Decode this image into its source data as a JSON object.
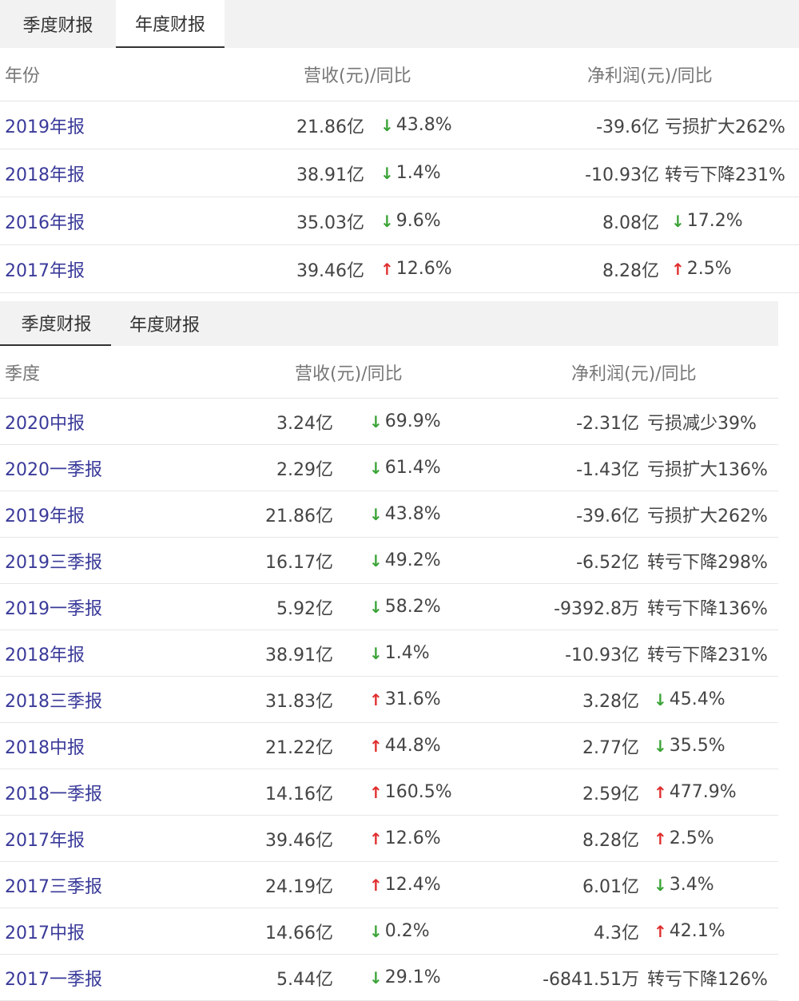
{
  "annual_panel": {
    "tabs": [
      {
        "label": "季度财报",
        "active": false
      },
      {
        "label": "年度财报",
        "active": true
      }
    ],
    "headers": {
      "period": "年份",
      "revenue": "营收(元)/同比",
      "net_profit": "净利润(元)/同比"
    },
    "rows": [
      {
        "period": "2019年报",
        "revenue": "21.86亿",
        "revenue_dir": "down",
        "revenue_yoy": "43.8%",
        "net_profit": "-39.6亿",
        "np_dir": "none",
        "np_change": "亏损扩大262%"
      },
      {
        "period": "2018年报",
        "revenue": "38.91亿",
        "revenue_dir": "down",
        "revenue_yoy": "1.4%",
        "net_profit": "-10.93亿",
        "np_dir": "none",
        "np_change": "转亏下降231%"
      },
      {
        "period": "2016年报",
        "revenue": "35.03亿",
        "revenue_dir": "down",
        "revenue_yoy": "9.6%",
        "net_profit": "8.08亿",
        "np_dir": "down",
        "np_change": "17.2%"
      },
      {
        "period": "2017年报",
        "revenue": "39.46亿",
        "revenue_dir": "up",
        "revenue_yoy": "12.6%",
        "net_profit": "8.28亿",
        "np_dir": "up",
        "np_change": "2.5%"
      }
    ]
  },
  "quarterly_panel": {
    "tabs": [
      {
        "label": "季度财报",
        "active": true
      },
      {
        "label": "年度财报",
        "active": false
      }
    ],
    "headers": {
      "period": "季度",
      "revenue": "营收(元)/同比",
      "net_profit": "净利润(元)/同比"
    },
    "rows": [
      {
        "period": "2020中报",
        "revenue": "3.24亿",
        "revenue_dir": "down",
        "revenue_yoy": "69.9%",
        "net_profit": "-2.31亿",
        "np_dir": "none",
        "np_change": "亏损减少39%"
      },
      {
        "period": "2020一季报",
        "revenue": "2.29亿",
        "revenue_dir": "down",
        "revenue_yoy": "61.4%",
        "net_profit": "-1.43亿",
        "np_dir": "none",
        "np_change": "亏损扩大136%"
      },
      {
        "period": "2019年报",
        "revenue": "21.86亿",
        "revenue_dir": "down",
        "revenue_yoy": "43.8%",
        "net_profit": "-39.6亿",
        "np_dir": "none",
        "np_change": "亏损扩大262%"
      },
      {
        "period": "2019三季报",
        "revenue": "16.17亿",
        "revenue_dir": "down",
        "revenue_yoy": "49.2%",
        "net_profit": "-6.52亿",
        "np_dir": "none",
        "np_change": "转亏下降298%"
      },
      {
        "period": "2019一季报",
        "revenue": "5.92亿",
        "revenue_dir": "down",
        "revenue_yoy": "58.2%",
        "net_profit": "-9392.8万",
        "np_dir": "none",
        "np_change": "转亏下降136%"
      },
      {
        "period": "2018年报",
        "revenue": "38.91亿",
        "revenue_dir": "down",
        "revenue_yoy": "1.4%",
        "net_profit": "-10.93亿",
        "np_dir": "none",
        "np_change": "转亏下降231%"
      },
      {
        "period": "2018三季报",
        "revenue": "31.83亿",
        "revenue_dir": "up",
        "revenue_yoy": "31.6%",
        "net_profit": "3.28亿",
        "np_dir": "down",
        "np_change": "45.4%"
      },
      {
        "period": "2018中报",
        "revenue": "21.22亿",
        "revenue_dir": "up",
        "revenue_yoy": "44.8%",
        "net_profit": "2.77亿",
        "np_dir": "down",
        "np_change": "35.5%"
      },
      {
        "period": "2018一季报",
        "revenue": "14.16亿",
        "revenue_dir": "up",
        "revenue_yoy": "160.5%",
        "net_profit": "2.59亿",
        "np_dir": "up",
        "np_change": "477.9%"
      },
      {
        "period": "2017年报",
        "revenue": "39.46亿",
        "revenue_dir": "up",
        "revenue_yoy": "12.6%",
        "net_profit": "8.28亿",
        "np_dir": "up",
        "np_change": "2.5%"
      },
      {
        "period": "2017三季报",
        "revenue": "24.19亿",
        "revenue_dir": "up",
        "revenue_yoy": "12.4%",
        "net_profit": "6.01亿",
        "np_dir": "down",
        "np_change": "3.4%"
      },
      {
        "period": "2017中报",
        "revenue": "14.66亿",
        "revenue_dir": "down",
        "revenue_yoy": "0.2%",
        "net_profit": "4.3亿",
        "np_dir": "up",
        "np_change": "42.1%"
      },
      {
        "period": "2017一季报",
        "revenue": "5.44亿",
        "revenue_dir": "down",
        "revenue_yoy": "29.1%",
        "net_profit": "-6841.51万",
        "np_dir": "none",
        "np_change": "转亏下降126%"
      }
    ]
  },
  "colors": {
    "link": "#3a3a9a",
    "up": "#e02c2c",
    "down": "#3aa336",
    "tabbar_bg": "#f2f2f2",
    "divider": "#e6e6e6"
  }
}
